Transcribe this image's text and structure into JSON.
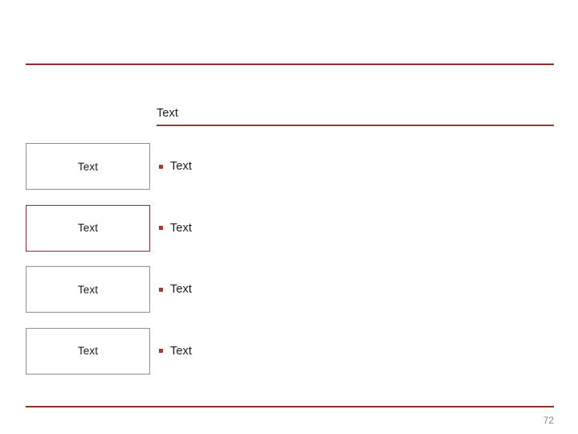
{
  "slide": {
    "heading": "Text",
    "page_number": "72",
    "accent_color": "#8B3030",
    "rule_color": "#8B3030",
    "box_border_color": "#909090",
    "box_accent_border_color": "#8B3030",
    "bullet_marker_color": "#9B3A3A",
    "page_number_color": "#8c8c8c",
    "text_color": "#1a1a1a",
    "background_color": "#ffffff"
  },
  "rows": [
    {
      "box_label": "Text",
      "bullet_label": "Text",
      "bullet_icon": "square-bullet-icon",
      "accent": false
    },
    {
      "box_label": "Text",
      "bullet_label": "Text",
      "bullet_icon": "square-bullet-icon",
      "accent": true
    },
    {
      "box_label": "Text",
      "bullet_label": "Text",
      "bullet_icon": "square-bullet-icon",
      "accent": false
    },
    {
      "box_label": "Text",
      "bullet_label": "Text",
      "bullet_icon": "square-bullet-icon",
      "accent": false
    }
  ]
}
